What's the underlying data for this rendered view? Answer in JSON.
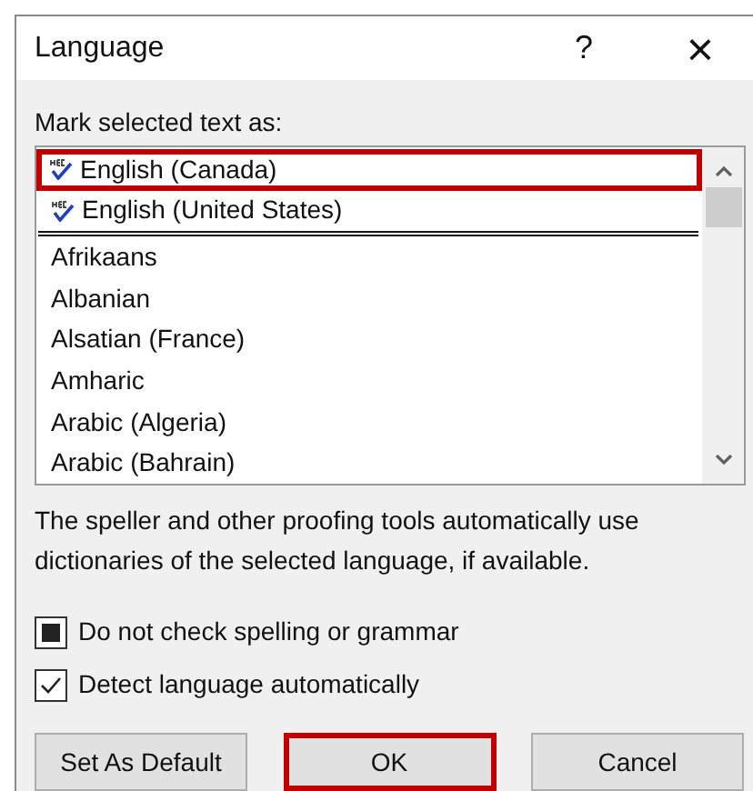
{
  "window": {
    "title": "Language",
    "help": "?",
    "close": "×"
  },
  "list_label": {
    "text": "Mark selected text as:"
  },
  "languages": [
    {
      "label": "English (Canada)",
      "kind": "proofing",
      "selected": true,
      "separator_after": false
    },
    {
      "label": "English (United States)",
      "kind": "proofing",
      "selected": false,
      "separator_after": true
    },
    {
      "label": "Afrikaans",
      "kind": "plain",
      "selected": false,
      "separator_after": false
    },
    {
      "label": "Albanian",
      "kind": "plain",
      "selected": false,
      "separator_after": false
    },
    {
      "label": "Alsatian (France)",
      "kind": "plain",
      "selected": false,
      "separator_after": false
    },
    {
      "label": "Amharic",
      "kind": "plain",
      "selected": false,
      "separator_after": false
    },
    {
      "label": "Arabic (Algeria)",
      "kind": "plain",
      "selected": false,
      "separator_after": false
    },
    {
      "label": "Arabic (Bahrain)",
      "kind": "plain",
      "selected": false,
      "separator_after": false
    }
  ],
  "description": "The speller and other proofing tools automatically use dictionaries of the selected language, if available.",
  "options": [
    {
      "label": "Do not check spelling or grammar",
      "checked": true,
      "indeterminate": true
    },
    {
      "label": "Detect language automatically",
      "checked": true,
      "indeterminate": false
    }
  ],
  "buttons": [
    {
      "label": "Set As Default",
      "default": false
    },
    {
      "label": "OK",
      "default": true
    },
    {
      "label": "Cancel",
      "default": false
    }
  ]
}
